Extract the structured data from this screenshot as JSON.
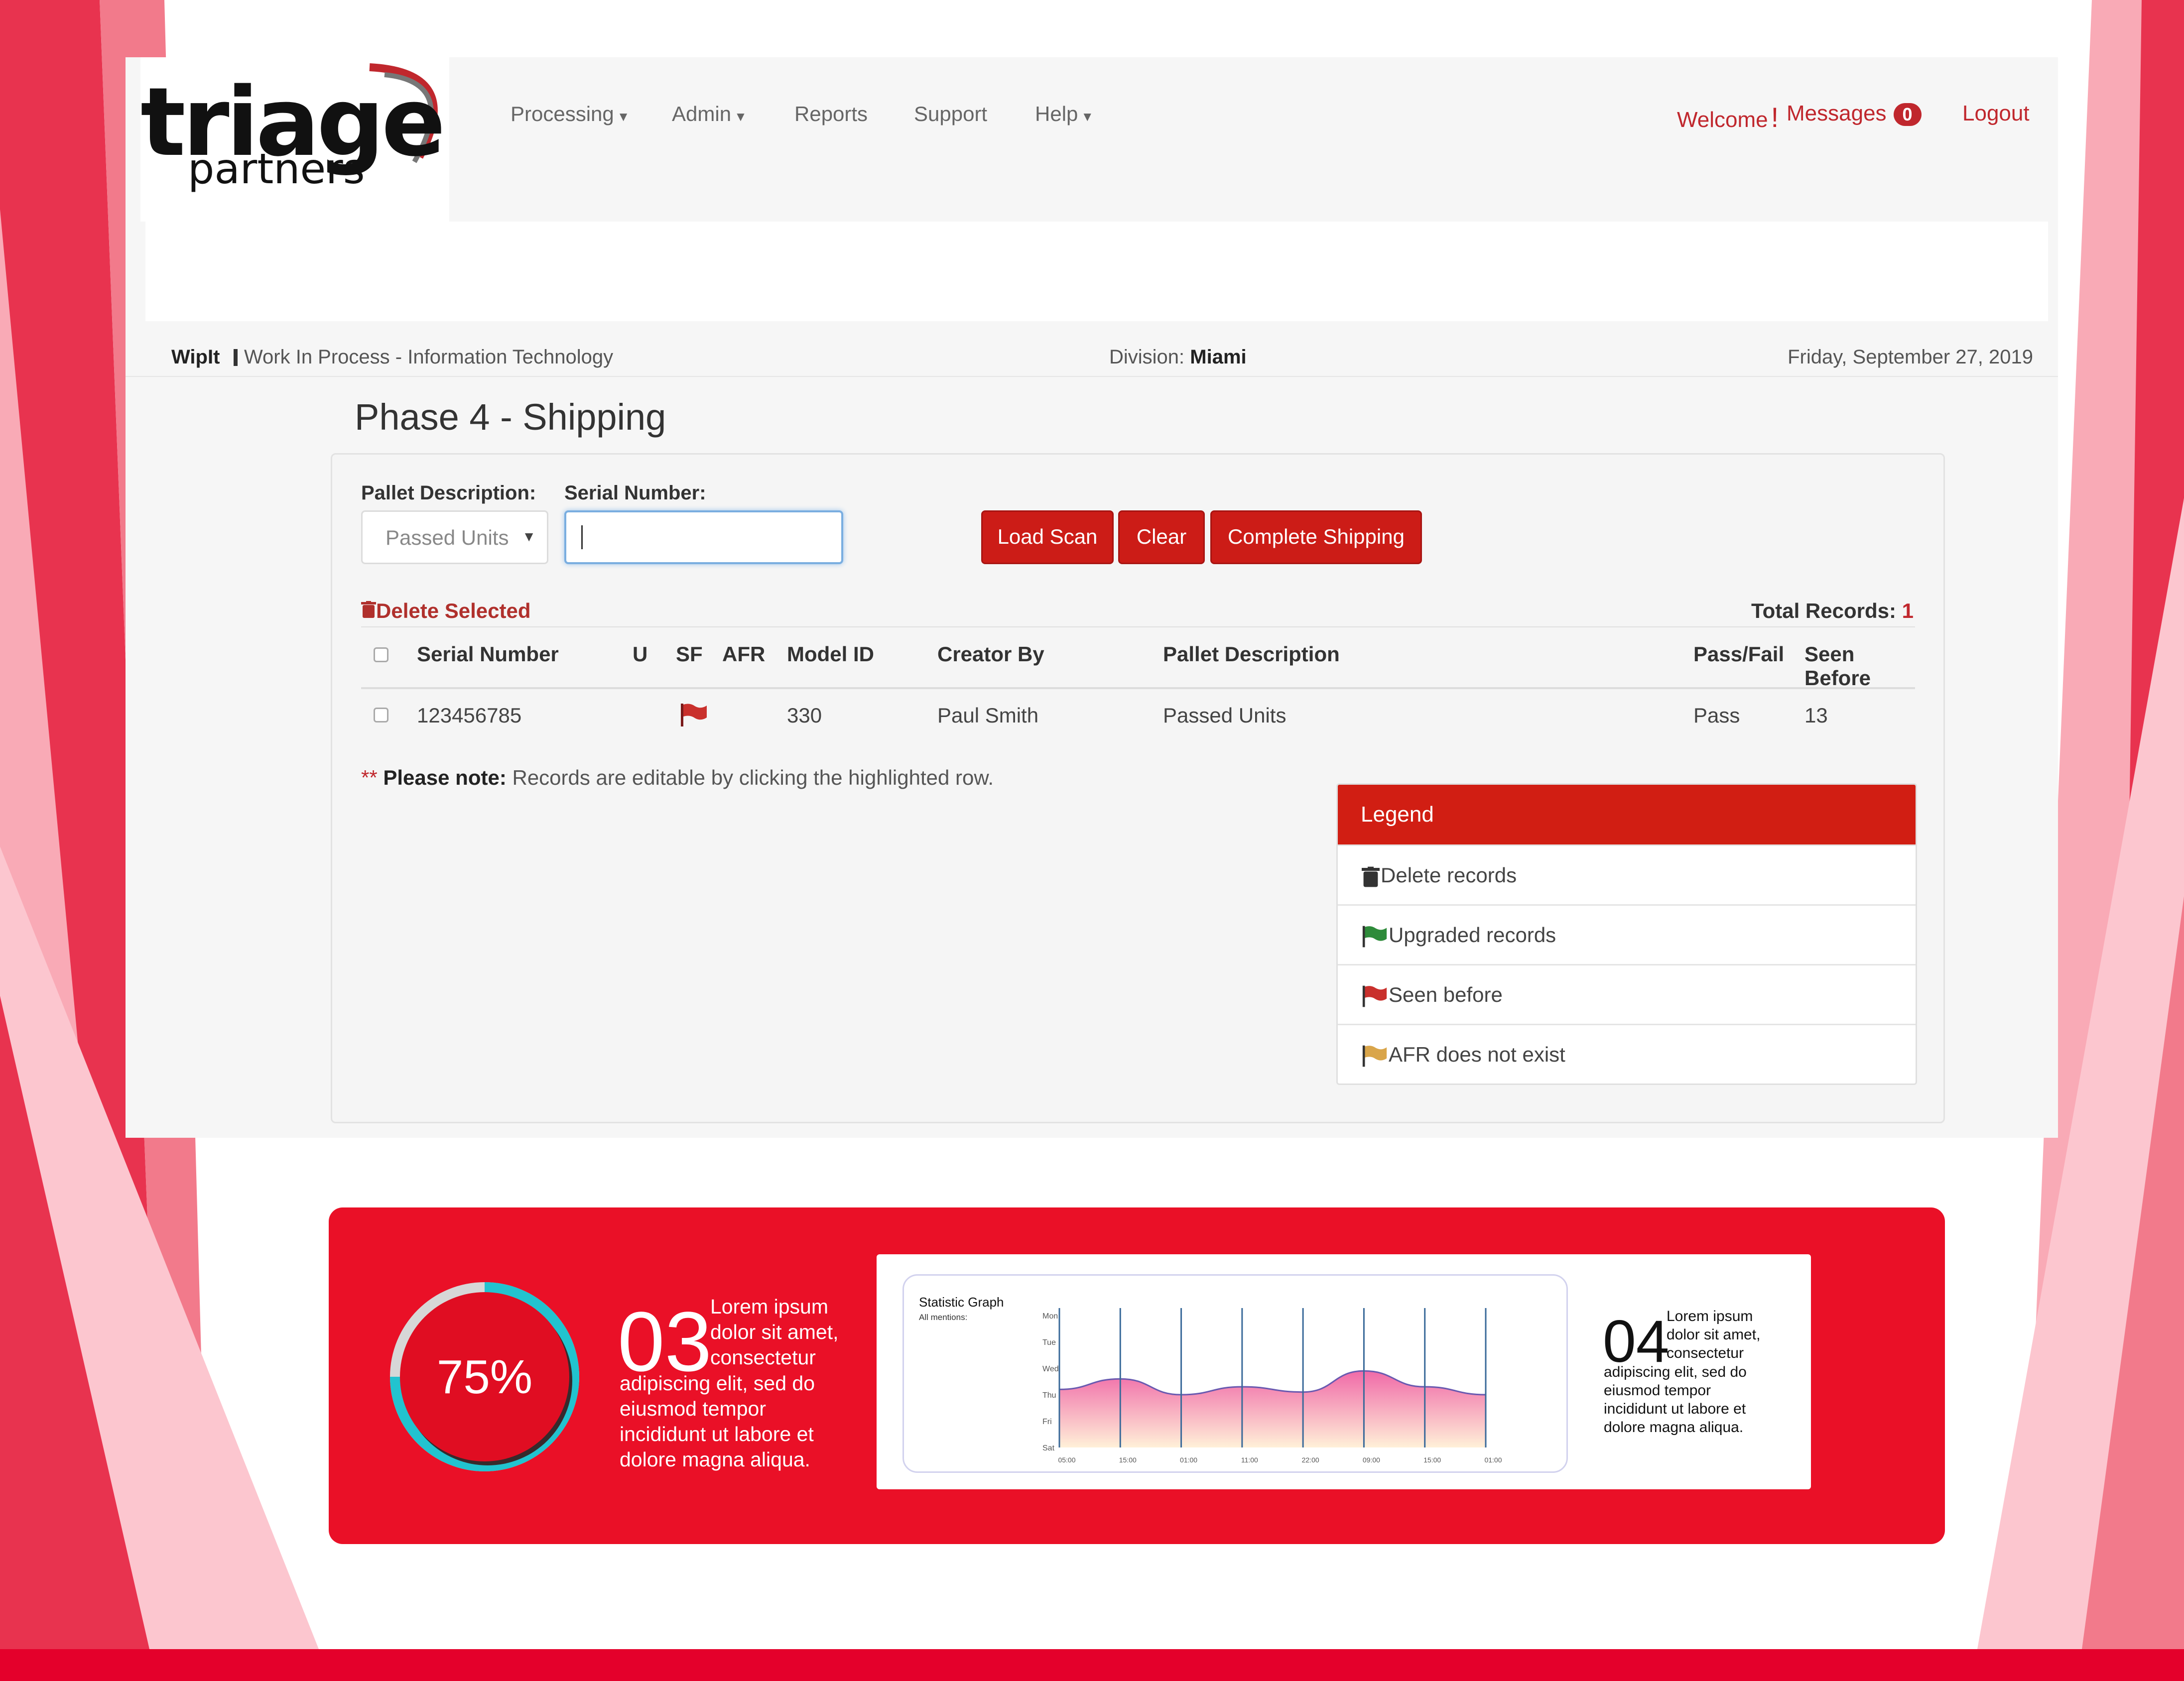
{
  "brand": {
    "logo_main": "triage",
    "logo_sub": "partners",
    "accent": "#c0272d"
  },
  "nav": {
    "items": [
      {
        "label": "Processing",
        "dropdown": true
      },
      {
        "label": "Admin",
        "dropdown": true
      },
      {
        "label": "Reports",
        "dropdown": false
      },
      {
        "label": "Support",
        "dropdown": false
      },
      {
        "label": "Help",
        "dropdown": true
      }
    ],
    "welcome": "Welcome",
    "welcome_mark": "!",
    "messages_label": "Messages",
    "messages_count": "0",
    "logout": "Logout"
  },
  "infobar": {
    "app_name": "WipIt",
    "app_desc": "Work In Process - Information Technology",
    "division_label": "Division:",
    "division_value": "Miami",
    "date": "Friday, September 27, 2019"
  },
  "page": {
    "title": "Phase 4 - Shipping"
  },
  "form": {
    "pallet_label": "Pallet Description:",
    "pallet_value": "Passed Units",
    "serial_label": "Serial Number:",
    "serial_value": "",
    "buttons": {
      "load": "Load Scan",
      "clear": "Clear",
      "complete": "Complete Shipping"
    }
  },
  "records": {
    "delete_selected": "Delete Selected",
    "total_label": "Total Records:",
    "total_value": "1",
    "columns": [
      "Serial Number",
      "U",
      "SF",
      "AFR",
      "Model ID",
      "Creator By",
      "Pallet Description",
      "Pass/Fail",
      "Seen Before"
    ],
    "rows": [
      {
        "serial": "123456785",
        "u": "",
        "sf": "red-flag-icon",
        "afr": "",
        "model_id": "330",
        "creator": "Paul Smith",
        "pallet": "Passed Units",
        "pass_fail": "Pass",
        "seen_before": "13"
      }
    ]
  },
  "note": {
    "stars": "**",
    "bold": "Please note:",
    "text": "Records are editable by clicking the highlighted row."
  },
  "legend": {
    "title": "Legend",
    "items": [
      {
        "icon": "trash-icon",
        "label": "Delete records",
        "color": "#333333"
      },
      {
        "icon": "green-flag-icon",
        "label": "Upgraded records",
        "color": "#2e8b3a"
      },
      {
        "icon": "red-flag-icon",
        "label": "Seen before",
        "color": "#c9302c"
      },
      {
        "icon": "orange-flag-icon",
        "label": "AFR does not exist",
        "color": "#d9a54a"
      }
    ]
  },
  "infographic": {
    "percent": 75,
    "percent_label": "75%",
    "block1_num": "03",
    "block1_text_top": [
      "Lorem ipsum",
      "dolor sit amet,",
      "consectetur"
    ],
    "block1_text_bottom": [
      "adipiscing elit, sed do",
      "eiusmod tempor",
      "incididunt ut labore et",
      "dolore magna aliqua."
    ],
    "block2_num": "04",
    "block2_text_top": [
      "Lorem ipsum",
      "dolor sit amet,",
      "consectetur"
    ],
    "block2_text_bottom": [
      "adipiscing elit, sed do",
      "eiusmod tempor",
      "incididunt ut labore et",
      "dolore magna aliqua."
    ]
  },
  "chart_data": {
    "type": "area",
    "title": "Statistic Graph",
    "subtitle": "All mentions:",
    "y_categories": [
      "Mon",
      "Tue",
      "Wed",
      "Thu",
      "Fri",
      "Sat"
    ],
    "x": [
      "05:00",
      "15:00",
      "01:00",
      "11:00",
      "22:00",
      "09:00",
      "15:00",
      "01:00"
    ],
    "values": [
      2.2,
      2.6,
      2.0,
      2.3,
      2.1,
      2.9,
      2.3,
      2.0
    ],
    "grid": true,
    "legend": "none"
  }
}
